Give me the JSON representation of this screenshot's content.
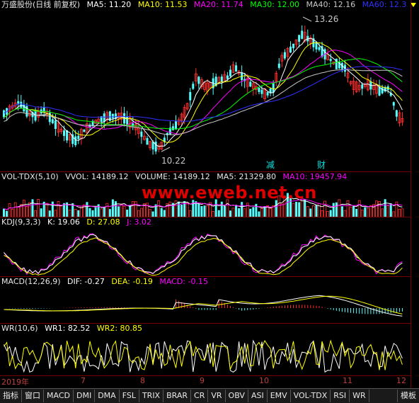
{
  "colors": {
    "up": "#ff3030",
    "down": "#54ffff",
    "ma5": "#ffffff",
    "ma10": "#ffff00",
    "ma20": "#ff00ff",
    "ma30": "#00ff00",
    "ma40": "#c8c8c8",
    "ma60": "#3030ff",
    "grid": "#7a0000",
    "axis_text": "#c04040"
  },
  "main": {
    "stock": "万盛股份(日线 前复权)",
    "ma5": "MA5: 11.20",
    "ma10": "MA10: 11.53",
    "ma20": "MA20: 11.74",
    "ma30": "MA30: 12.00",
    "ma40": "MA40: 12.16",
    "ma60": "MA60: 12.3",
    "high_label": "13.26",
    "low_label": "10.22",
    "mark1": "减",
    "mark2": "财"
  },
  "vol": {
    "name": "VOL-TDX(5,10)",
    "vvol": "VVOL: 14189.12",
    "volume": "VOLUME: 14189.12",
    "ma5": "MA5: 21329.80",
    "ma10": "MA10: 19457.94"
  },
  "kdj": {
    "name": "KDJ(9,3,3)",
    "k": "K: 19.06",
    "d": "D: 27.08",
    "j": "J: 3.02"
  },
  "macd": {
    "name": "MACD(12,26,9)",
    "dif": "DIF: -0.27",
    "dea": "DEA: -0.19",
    "macd": "MACD: -0.15"
  },
  "wr": {
    "name": "WR(10,6)",
    "wr1": "WR1: 82.52",
    "wr2": "WR2: 80.85"
  },
  "watermark": "www.eweb.net.cn",
  "axis_labels": [
    "2019年",
    "7",
    "8",
    "9",
    "10",
    "11",
    "12"
  ],
  "tabs": [
    "指标",
    "窗口",
    "MACD",
    "DMI",
    "DMA",
    "FSL",
    "TRIX",
    "BRAR",
    "CR",
    "VR",
    "OBV",
    "ASI",
    "EMV",
    "VOL-TDX",
    "RSI",
    "WR"
  ],
  "tab_right": "模板"
}
